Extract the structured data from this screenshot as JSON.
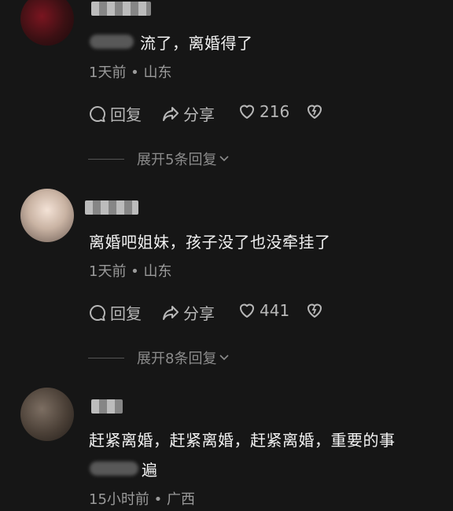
{
  "comments": [
    {
      "text": "流了，离婚得了",
      "time": "1天前",
      "location": "山东",
      "reply_label": "回复",
      "share_label": "分享",
      "likes": "216",
      "expand_label": "展开5条回复"
    },
    {
      "text": "离婚吧姐妹，孩子没了也没牵挂了",
      "time": "1天前",
      "location": "山东",
      "reply_label": "回复",
      "share_label": "分享",
      "likes": "441",
      "expand_label": "展开8条回复"
    },
    {
      "text_line1": "赶紧离婚，赶紧离婚，赶紧离婚，重要的事",
      "text_line2": "遍",
      "time": "15小时前",
      "location": "广西"
    }
  ],
  "separator": " • ",
  "colors": {
    "background": "#161616",
    "text": "#f2f2f2",
    "meta": "#9a9a9a",
    "action": "#b8b8b8"
  },
  "icons": [
    "reply-bubble-icon",
    "share-arrow-icon",
    "heart-icon",
    "broken-heart-icon",
    "chevron-down-icon"
  ]
}
